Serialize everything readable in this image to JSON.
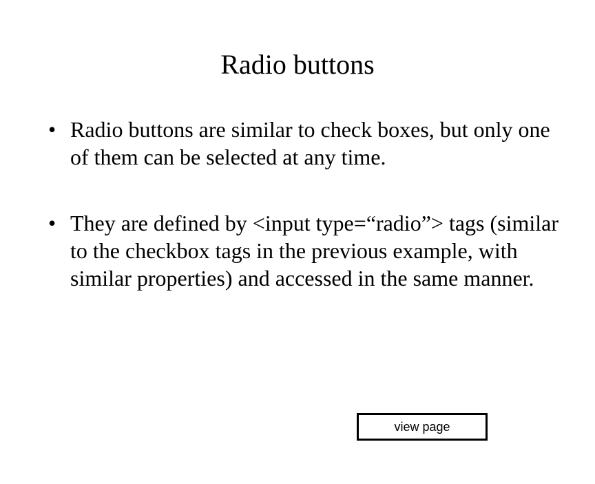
{
  "title": "Radio buttons",
  "bullets": [
    "Radio buttons are similar to check boxes, but only one of them can be selected at any time.",
    "They are defined by <input type=“radio”> tags (similar to the checkbox tags in the previous example, with similar properties) and accessed in the same manner."
  ],
  "button_label": "view page"
}
